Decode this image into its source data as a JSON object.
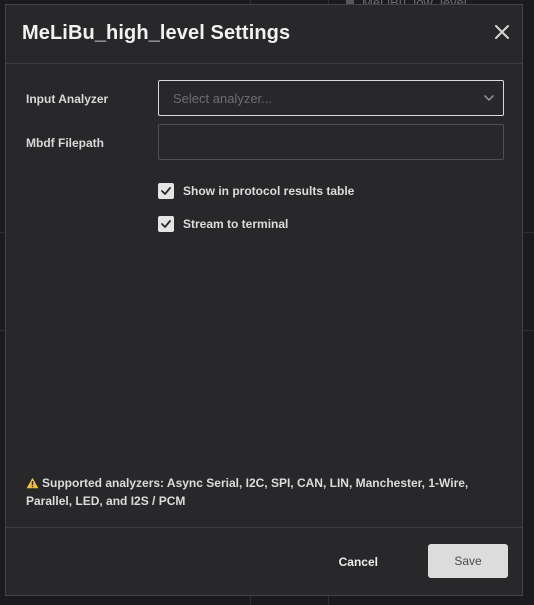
{
  "background": {
    "peek_text": "MeLiBu_low_level"
  },
  "dialog": {
    "title": "MeLiBu_high_level Settings",
    "close_icon": "close-icon",
    "fields": {
      "input_analyzer": {
        "label": "Input Analyzer",
        "placeholder": "Select analyzer...",
        "value": ""
      },
      "mbdf_filepath": {
        "label": "Mbdf Filepath",
        "value": ""
      }
    },
    "checkboxes": [
      {
        "label": "Show in protocol results table",
        "checked": true
      },
      {
        "label": "Stream to terminal",
        "checked": true
      }
    ],
    "note": {
      "icon": "warning-icon",
      "text": "Supported analyzers: Async Serial, I2C, SPI, CAN, LIN, Manchester, 1-Wire, Parallel, LED, and I2S / PCM"
    },
    "footer": {
      "cancel_label": "Cancel",
      "save_label": "Save"
    }
  },
  "colors": {
    "dialog_bg": "#28282b",
    "page_bg": "#1b1b1d",
    "border": "#454549",
    "warning": "#f0c040"
  }
}
